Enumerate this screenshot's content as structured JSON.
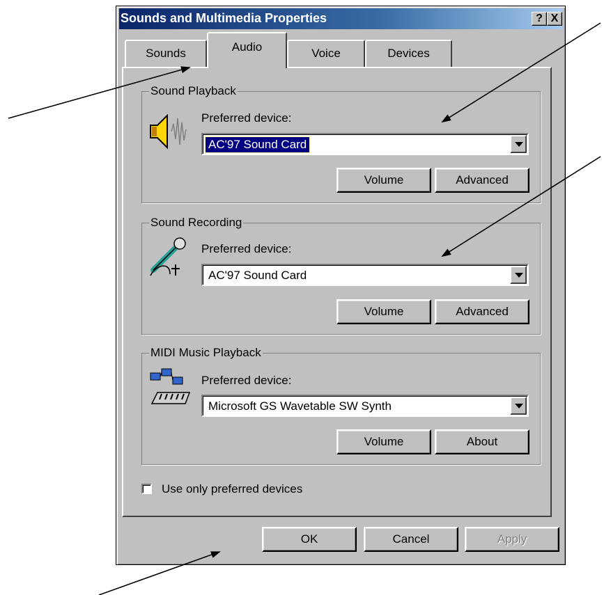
{
  "window": {
    "title": "Sounds and Multimedia Properties",
    "help_label": "?",
    "close_label": "X"
  },
  "tabs": [
    {
      "label": "Sounds",
      "active": false
    },
    {
      "label": "Audio",
      "active": true
    },
    {
      "label": "Voice",
      "active": false
    },
    {
      "label": "Devices",
      "active": false
    }
  ],
  "sound_playback": {
    "group_label": "Sound Playback",
    "device_label": "Preferred device:",
    "selected_device": "AC'97 Sound Card",
    "volume_label": "Volume",
    "advanced_label": "Advanced",
    "icon": "speaker-icon"
  },
  "sound_recording": {
    "group_label": "Sound Recording",
    "device_label": "Preferred device:",
    "selected_device": "AC'97 Sound Card",
    "volume_label": "Volume",
    "advanced_label": "Advanced",
    "icon": "microphone-icon"
  },
  "midi_playback": {
    "group_label": "MIDI Music Playback",
    "device_label": "Preferred device:",
    "selected_device": "Microsoft GS Wavetable SW Synth",
    "volume_label": "Volume",
    "about_label": "About",
    "icon": "midi-keyboard-icon"
  },
  "options": {
    "use_only_preferred_label": "Use only preferred devices",
    "use_only_preferred_checked": false
  },
  "footer": {
    "ok_label": "OK",
    "cancel_label": "Cancel",
    "apply_label": "Apply",
    "apply_enabled": false
  },
  "colors": {
    "face": "#c0c0c0",
    "title_start": "#0a246a",
    "title_end": "#a6caf0",
    "selection": "#000080"
  }
}
